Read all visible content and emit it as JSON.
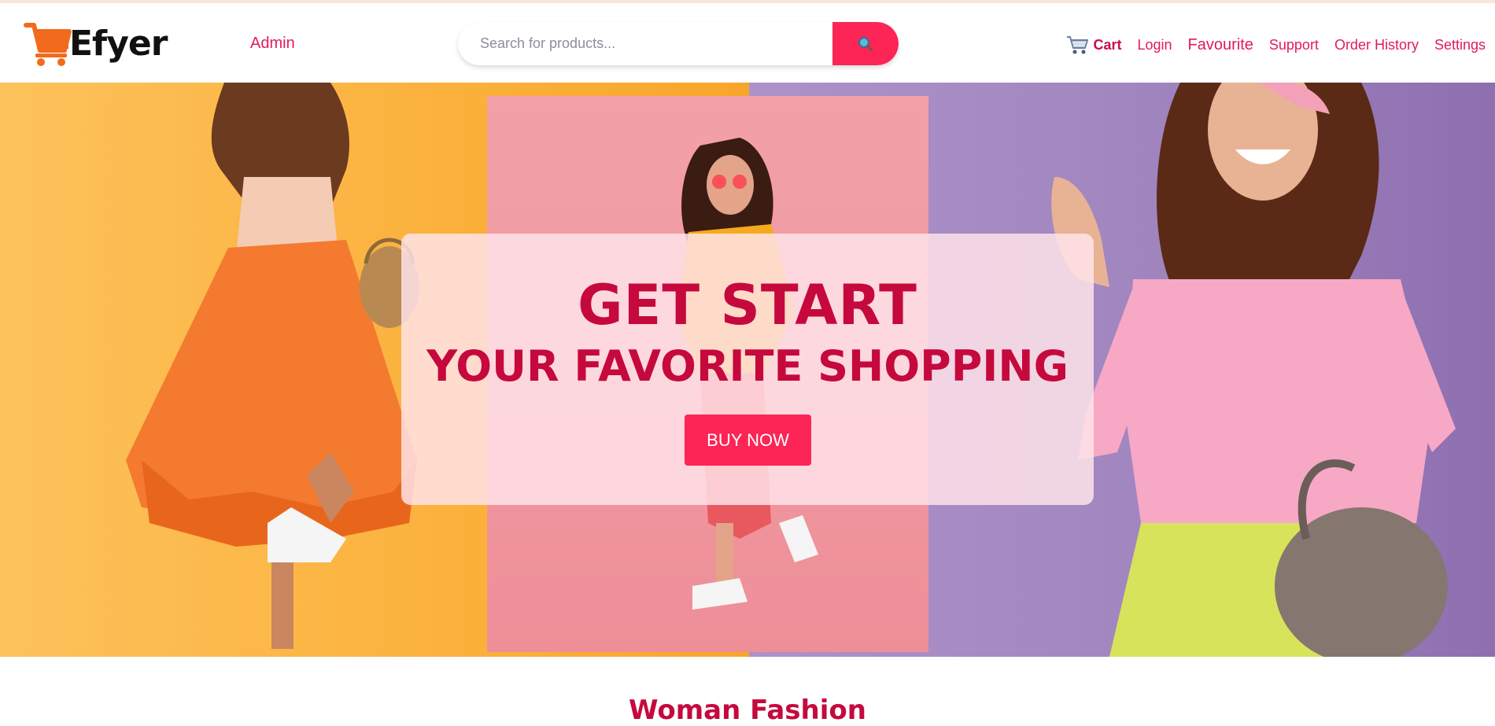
{
  "app": {
    "brand": "Efyer"
  },
  "header": {
    "admin_label": "Admin",
    "search": {
      "placeholder": "Search for products...",
      "value": "",
      "button_icon": "search-icon"
    },
    "nav": {
      "cart_label": "Cart",
      "login_label": "Login",
      "favourite_label": "Favourite",
      "support_label": "Support",
      "order_history_label": "Order History",
      "settings_label": "Settings"
    }
  },
  "hero": {
    "headline": "GET START",
    "subheadline": "YOUR FAVORITE SHOPPING",
    "cta_label": "BUY NOW"
  },
  "section": {
    "title": "Woman Fashion"
  },
  "colors": {
    "accent": "#fc2556",
    "heading": "#c5093d",
    "link": "#e3195f",
    "logo_orange": "#f26b1d",
    "panel_yellow": "#fbb13c",
    "panel_pink": "#f2a1a7",
    "panel_purple": "#a286c0"
  }
}
